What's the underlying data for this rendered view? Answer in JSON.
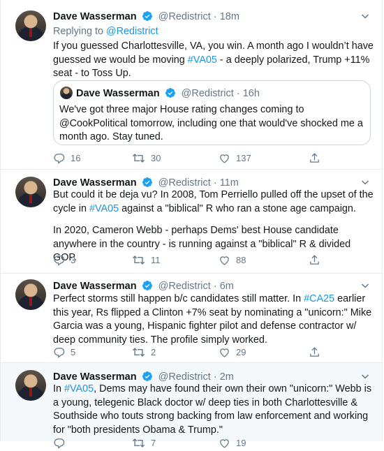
{
  "colors": {
    "link": "#1b95e0",
    "muted": "#657786",
    "border": "#e6ecf0",
    "verified": "#1da1f2"
  },
  "tweets": [
    {
      "name": "Dave Wasserman",
      "handle": "@Redistrict",
      "sep": "·",
      "time": "18m",
      "replying_prefix": "Replying to",
      "replying_to": "@Redistrict",
      "text_parts": [
        "If you guessed Charlottesville, VA, you win. A month ago I wouldn’t  have guessed we would be moving ",
        "#VA05",
        " - a deeply polarized, Trump +11% seat - to Toss Up."
      ],
      "quote": {
        "name": "Dave Wasserman",
        "handle": "@Redistrict",
        "sep": "·",
        "time": "16h",
        "text": "We've got three major House rating changes coming to @CookPolitical tomorrow, including one that would've shocked me a month ago. Stay tuned."
      },
      "replies": "16",
      "retweets": "30",
      "likes": "137"
    },
    {
      "name": "Dave Wasserman",
      "handle": "@Redistrict",
      "sep": "·",
      "time": "11m",
      "p1_parts": [
        "But could it be deja vu? In 2008, Tom Perriello pulled off the upset of the cycle in ",
        "#VA05",
        " against a \"biblical\" R who ran a stone age campaign."
      ],
      "p2": "In 2020, Cameron Webb - perhaps Dems' best House candidate anywhere in the country - is running against a \"biblical\" R & divided GOP.",
      "replies": "3",
      "retweets": "11",
      "likes": "88"
    },
    {
      "name": "Dave Wasserman",
      "handle": "@Redistrict",
      "sep": "·",
      "time": "6m",
      "text_parts": [
        "Perfect storms still happen b/c candidates still matter. In ",
        "#CA25",
        " earlier this year, Rs flipped a Clinton +7% seat by nominating a \"unicorn:\" Mike Garcia was a young, Hispanic fighter pilot and defense contractor w/ deep community ties. The profile simply worked."
      ],
      "replies": "5",
      "retweets": "2",
      "likes": "29"
    },
    {
      "name": "Dave Wasserman",
      "handle": "@Redistrict",
      "sep": "·",
      "time": "2m",
      "text_parts": [
        "In ",
        "#VA05",
        ", Dems may have found their own their own \"unicorn:\" Webb is a young, telegenic Black doctor w/ deep ties in both Charlottesville & Southside who touts strong backing from law enforcement and working for \"both presidents Obama & Trump.\""
      ],
      "replies": "",
      "retweets": "7",
      "likes": "19"
    }
  ]
}
